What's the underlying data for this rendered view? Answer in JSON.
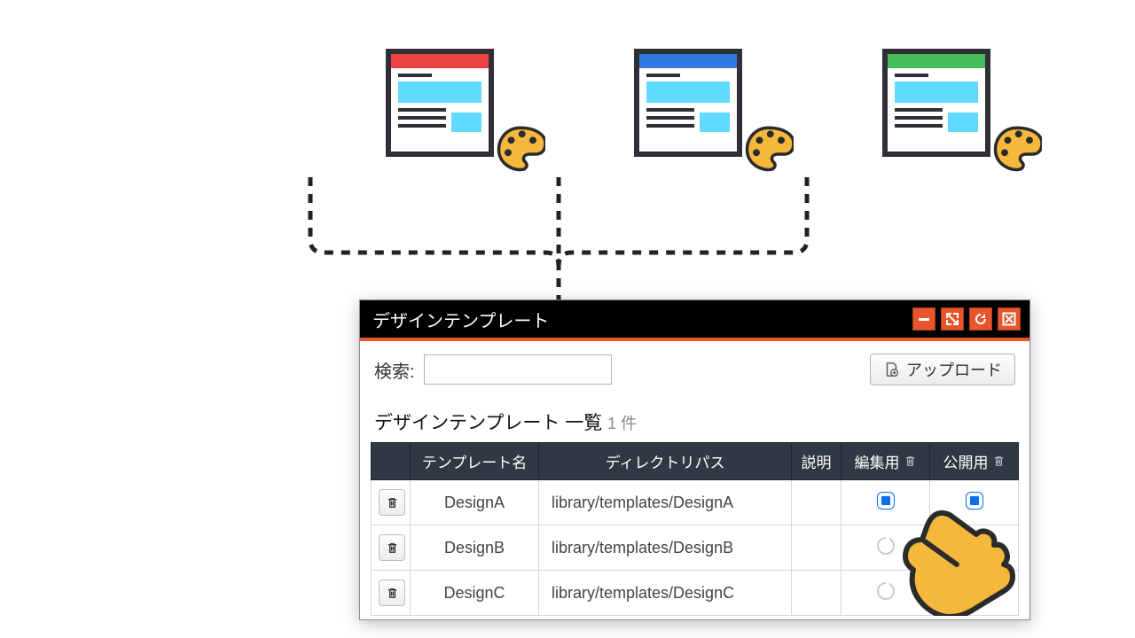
{
  "thumbs": [
    {
      "color": "th-red"
    },
    {
      "color": "th-blue"
    },
    {
      "color": "th-green"
    }
  ],
  "window": {
    "title": "デザインテンプレート"
  },
  "toolbar": {
    "search_label": "検索:",
    "upload_label": "アップロード"
  },
  "list": {
    "heading": "デザインテンプレート 一覧",
    "count_value": "1",
    "count_suffix": "件"
  },
  "columns": {
    "name": "テンプレート名",
    "path": "ディレクトリパス",
    "desc": "説明",
    "edit": "編集用",
    "publish": "公開用"
  },
  "rows": [
    {
      "name": "DesignA",
      "path": "library/templates/DesignA",
      "desc": "",
      "edit": "filled",
      "publish": "filled"
    },
    {
      "name": "DesignB",
      "path": "library/templates/DesignB",
      "desc": "",
      "edit": "empty",
      "publish": "empty"
    },
    {
      "name": "DesignC",
      "path": "library/templates/DesignC",
      "desc": "",
      "edit": "empty",
      "publish": "empty"
    }
  ]
}
